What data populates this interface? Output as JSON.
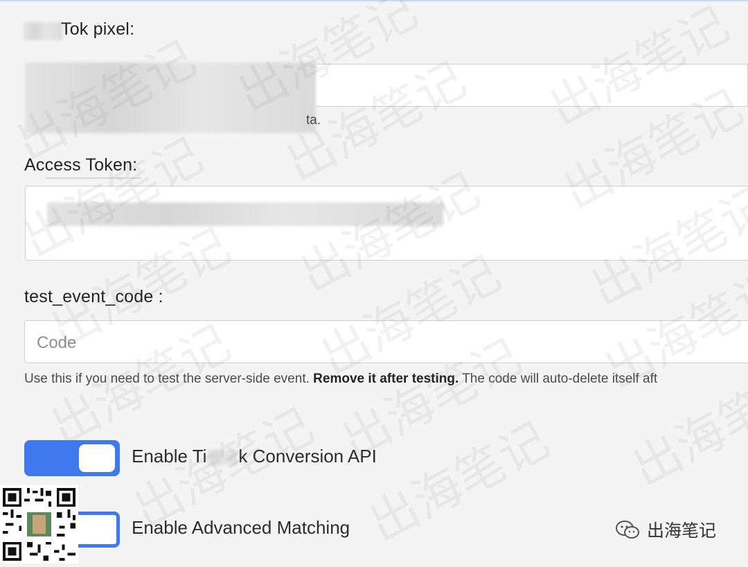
{
  "pixel": {
    "label": "Tok pixel:",
    "help_suffix": "ta."
  },
  "access_token": {
    "label": "Access Token:"
  },
  "test_event_code": {
    "label": "test_event_code :",
    "placeholder": "Code",
    "help_prefix": "Use this if you need to test the server-side event. ",
    "help_bold": "Remove it after testing.",
    "help_suffix": " The code will auto-delete itself aft"
  },
  "toggles": [
    {
      "label": "Enable Ti",
      "label_tail": "k Conversion API",
      "state": "on"
    },
    {
      "label": "Enable Advanced Matching",
      "state": "off"
    }
  ],
  "watermark": {
    "text": "出海笔记",
    "brand_name": "出海笔记"
  },
  "colors": {
    "accent": "#3f79f0",
    "background": "#f4f4f4",
    "field_border": "#cfcfcf"
  }
}
